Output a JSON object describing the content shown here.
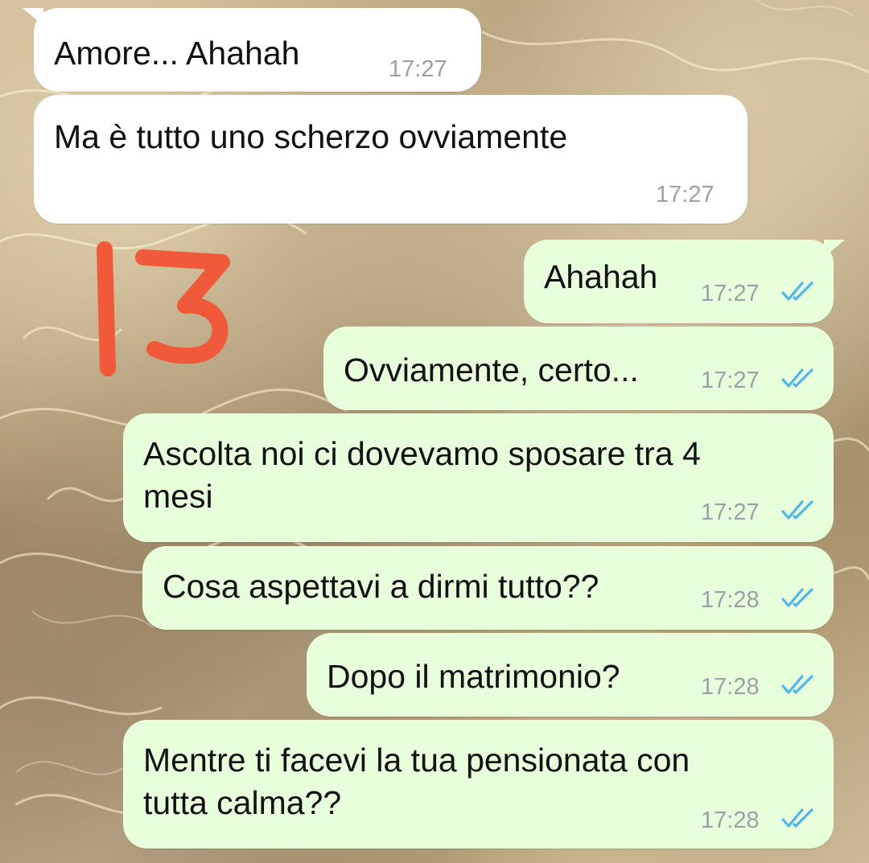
{
  "messages": [
    {
      "direction": "incoming",
      "text": "Amore... Ahahah",
      "time": "17:27"
    },
    {
      "direction": "incoming",
      "text": "Ma è tutto uno scherzo ovviamente",
      "time": "17:27"
    },
    {
      "direction": "outgoing",
      "text": "Ahahah",
      "time": "17:27",
      "status": "read"
    },
    {
      "direction": "outgoing",
      "text": "Ovviamente, certo...",
      "time": "17:27",
      "status": "read"
    },
    {
      "direction": "outgoing",
      "text": "Ascolta noi ci dovevamo sposare tra 4\nmesi",
      "time": "17:27",
      "status": "read"
    },
    {
      "direction": "outgoing",
      "text": "Cosa aspettavi a dirmi tutto??",
      "time": "17:28",
      "status": "read"
    },
    {
      "direction": "outgoing",
      "text": "Dopo il matrimonio?",
      "time": "17:28",
      "status": "read"
    },
    {
      "direction": "outgoing",
      "text": "Mentre ti facevi la tua pensionata con\ntutta calma??",
      "time": "17:28",
      "status": "read"
    }
  ],
  "overlay_number": "13",
  "icons": {
    "read_receipt": "double-check-icon"
  },
  "colors": {
    "incoming_bubble": "#ffffff",
    "outgoing_bubble": "#e7ffdb",
    "read_tick": "#4fb6ec",
    "timestamp": "#9aa0a6",
    "annotation": "#f05a3a"
  }
}
